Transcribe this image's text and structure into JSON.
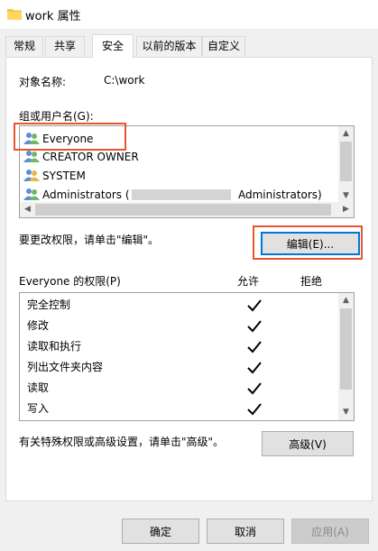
{
  "window": {
    "title": "work 属性"
  },
  "tabs": [
    {
      "label": "常规",
      "active": false
    },
    {
      "label": "共享",
      "active": false
    },
    {
      "label": "安全",
      "active": true
    },
    {
      "label": "以前的版本",
      "active": false
    },
    {
      "label": "自定义",
      "active": false
    }
  ],
  "object": {
    "name_label": "对象名称:",
    "name_value": "C:\\work"
  },
  "groups": {
    "label": "组或用户名(G):",
    "items": [
      {
        "name": "Everyone",
        "icon": "users-icon"
      },
      {
        "name": "CREATOR OWNER",
        "icon": "users-icon"
      },
      {
        "name": "SYSTEM",
        "icon": "users-icon"
      },
      {
        "name_start": "Administrators (",
        "name_end": "Administrators)",
        "icon": "users-icon"
      }
    ]
  },
  "edit": {
    "hint": "要更改权限，请单击\"编辑\"。",
    "button": "编辑(E)..."
  },
  "permissions": {
    "title": "Everyone 的权限(P)",
    "allow_header": "允许",
    "deny_header": "拒绝",
    "rows": [
      {
        "name": "完全控制",
        "allow": true,
        "deny": false
      },
      {
        "name": "修改",
        "allow": true,
        "deny": false
      },
      {
        "name": "读取和执行",
        "allow": true,
        "deny": false
      },
      {
        "name": "列出文件夹内容",
        "allow": true,
        "deny": false
      },
      {
        "name": "读取",
        "allow": true,
        "deny": false
      },
      {
        "name": "写入",
        "allow": true,
        "deny": false
      }
    ]
  },
  "advanced": {
    "hint": "有关特殊权限或高级设置，请单击\"高级\"。",
    "button": "高级(V)"
  },
  "footer": {
    "ok": "确定",
    "cancel": "取消",
    "apply": "应用(A)"
  },
  "colors": {
    "highlight": "#e8542f",
    "focus": "#0078d7",
    "panel": "#ffffff",
    "background": "#f0f0f0"
  }
}
